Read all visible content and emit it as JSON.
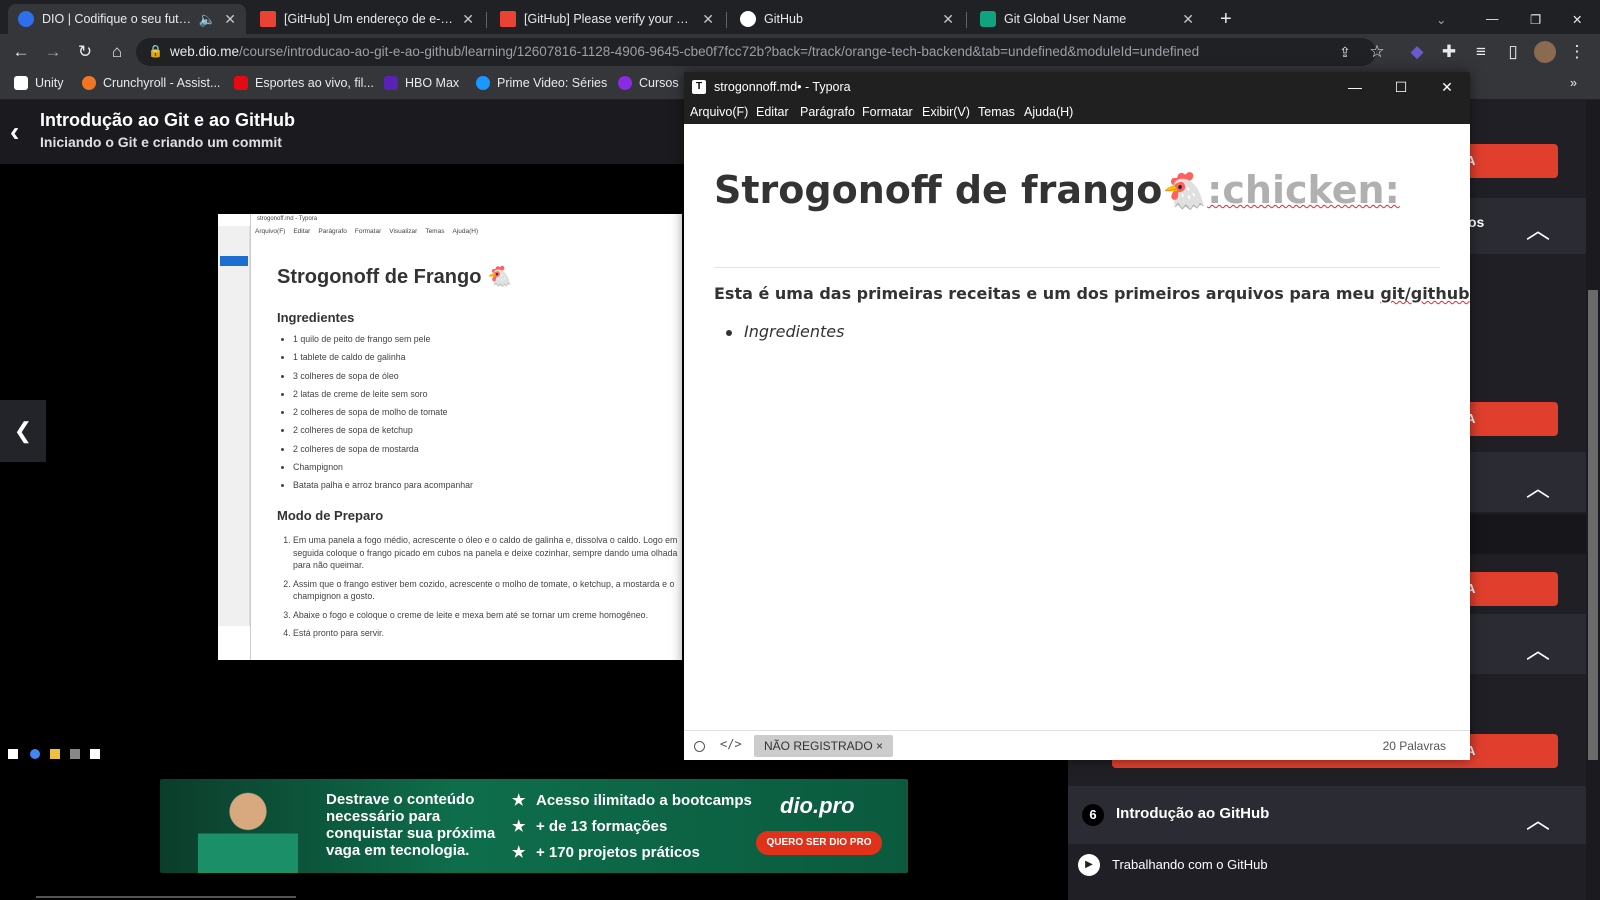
{
  "browser": {
    "tabs": [
      {
        "title": "DIO | Codifique o seu futuro",
        "active": true,
        "favicon_color": "#2f6feb",
        "audio_icon": "speaker-icon"
      },
      {
        "title": "[GitHub] Um endereço de e-mail",
        "active": false,
        "favicon_color": "#ea4335"
      },
      {
        "title": "[GitHub] Please verify your email",
        "active": false,
        "favicon_color": "#ea4335"
      },
      {
        "title": "GitHub",
        "active": false,
        "favicon_color": "#ffffff"
      },
      {
        "title": "Git Global User Name",
        "active": false,
        "favicon_color": "#10a37f"
      }
    ],
    "new_tab": "+",
    "url_host": "web.dio.me",
    "url_rest": "/course/introducao-ao-git-e-ao-github/learning/12607816-1128-4906-9645-cbe0f7fcc72b?back=/track/orange-tech-backend&tab=undefined&moduleId=undefined",
    "bookmarks": [
      {
        "label": "Unity",
        "icon_color": "#ffffff"
      },
      {
        "label": "Crunchyroll - Assist...",
        "icon_color": "#f47521"
      },
      {
        "label": "Esportes ao vivo, fil...",
        "icon_color": "#e50914"
      },
      {
        "label": "HBO Max",
        "icon_color": "#5822b4"
      },
      {
        "label": "Prime Video: Séries",
        "icon_color": "#1a98ff"
      },
      {
        "label": "Cursos",
        "icon_color": "#8a2be2"
      }
    ],
    "bookmarks_overflow": "»"
  },
  "dio": {
    "course_title": "Introdução ao Git e ao GitHub",
    "course_subtitle": "Iniciando o Git e criando um commit",
    "module": {
      "number": "6",
      "name": "Introdução ao GitHub"
    },
    "lesson": "Trabalhando com o GitHub",
    "button_fragment": "A",
    "section_fragment": "os",
    "banner": {
      "headline": "Destrave o conteúdo necessário para conquistar sua próxima vaga em tecnologia.",
      "features": [
        "Acesso ilimitado a bootcamps",
        "+ de 13 formações",
        "+ 170 projetos práticos"
      ],
      "logo": "dio.pro",
      "cta": "QUERO SER DIO PRO"
    }
  },
  "video": {
    "window_title": "strogonoff.md - Typora",
    "menu": [
      "Arquivo(F)",
      "Editar",
      "Parágrafo",
      "Formatar",
      "Visualizar",
      "Temas",
      "Ajuda(H)"
    ],
    "h1": "Strogonoff de Frango",
    "ingredients_heading": "Ingredientes",
    "ingredients": [
      "1 quilo de peito de frango sem pele",
      "1 tablete de caldo de galinha",
      "3 colheres de sopa de óleo",
      "2 latas de creme de leite sem soro",
      "2 colheres de sopa de molho de tomate",
      "2 colheres de sopa de ketchup",
      "2 colheres de sopa de mostarda",
      "Champignon",
      "Batata palha e arroz branco para acompanhar"
    ],
    "steps_heading": "Modo de Preparo",
    "steps": [
      "Em uma panela a fogo médio, acrescente o óleo e o caldo de galinha e, dissolva o caldo. Logo em seguida coloque o frango picado em cubos na panela e deixe cozinhar, sempre dando uma olhada para não queimar.",
      "Assim que o frango estiver bem cozido, acrescente o molho de tomate, o ketchup, a mostarda e o champignon a gosto.",
      "Abaixe o fogo e coloque o creme de leite e mexa bem até se tornar um creme homogêneo.",
      "Está pronto para servir."
    ]
  },
  "typora": {
    "window_title": "strogonnoff.md• - Typora",
    "menu": [
      "Arquivo(F)",
      "Editar",
      "Parágrafo",
      "Formatar",
      "Exibir(V)",
      "Temas",
      "Ajuda(H)"
    ],
    "h1_text": "Strogonoff de frango",
    "h1_emoji": "🐔",
    "h1_code": ":chicken:",
    "paragraph_text": "Esta é uma das primeiras receitas e um dos primeiros arquivos para meu ",
    "paragraph_spell": "git/github",
    "list_item": "Ingredientes",
    "status_badge": "NÃO REGISTRADO ×",
    "word_count": "20 Palavras"
  }
}
